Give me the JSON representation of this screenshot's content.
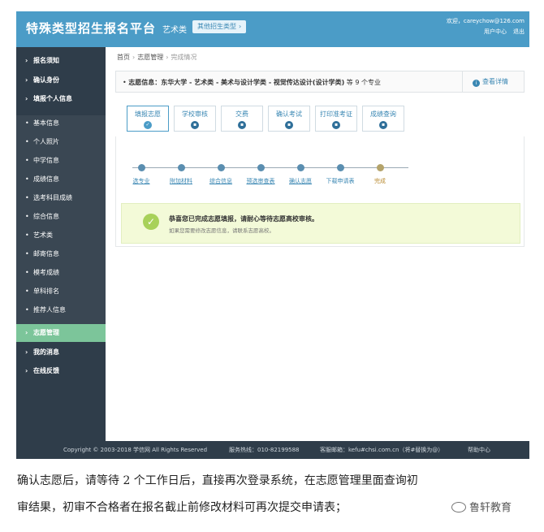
{
  "header": {
    "title": "特殊类型招生报名平台",
    "category": "艺术类",
    "switch_label": "其他招生类型",
    "welcome": "欢迎，careychow@126.com",
    "user_center": "用户中心",
    "logout": "退出"
  },
  "sidebar": {
    "items": [
      {
        "label": "报名须知"
      },
      {
        "label": "确认身份"
      },
      {
        "label": "填报个人信息"
      },
      {
        "label": "基本信息"
      },
      {
        "label": "个人照片"
      },
      {
        "label": "中学信息"
      },
      {
        "label": "成绩信息"
      },
      {
        "label": "选考科目成绩"
      },
      {
        "label": "综合信息"
      },
      {
        "label": "艺术类"
      },
      {
        "label": "邮寄信息"
      },
      {
        "label": "模考成绩"
      },
      {
        "label": "单科排名"
      },
      {
        "label": "推荐人信息"
      },
      {
        "label": "志愿管理"
      },
      {
        "label": "我的消息"
      },
      {
        "label": "在线反馈"
      }
    ]
  },
  "breadcrumb": {
    "home": "首页",
    "section": "志愿管理",
    "current": "完成情况"
  },
  "info": {
    "prefix": "志愿信息：",
    "text": "东华大学 - 艺术类 - 美术与设计学类 - 视觉传达设计(设计学类)",
    "count_text": "等 9 个专业",
    "detail_label": "查看详情"
  },
  "tabs": [
    {
      "label": "填报志愿"
    },
    {
      "label": "学校审核"
    },
    {
      "label": "交费"
    },
    {
      "label": "确认考试"
    },
    {
      "label": "打印准考证"
    },
    {
      "label": "成绩查询"
    }
  ],
  "steps": [
    {
      "label": "选专业"
    },
    {
      "label": "附加材料"
    },
    {
      "label": "综合信息"
    },
    {
      "label": "预选审查表"
    },
    {
      "label": "确认志愿"
    },
    {
      "label": "下载申请表"
    },
    {
      "label": "完成"
    }
  ],
  "success": {
    "message": "恭喜您已完成志愿填报，请耐心等待志愿高校审核。",
    "hint": "如果您需要修改志愿信息，请联系志愿高校。"
  },
  "footer": {
    "copyright": "Copyright © 2003-2018 学信网 All Rights Reserved",
    "hotline": "服务热线：010-82199588",
    "email": "客服邮箱：kefu#chsi.com.cn（将#替换为@）",
    "help": "帮助中心"
  },
  "caption": {
    "line1": "确认志愿后，请等待 2 个工作日后，直接再次登录系统，在志愿管理里面查询初",
    "line2": "审结果，初审不合格者在报名截止前修改材料可再次提交申请表；"
  },
  "watermark": "鲁轩教育"
}
